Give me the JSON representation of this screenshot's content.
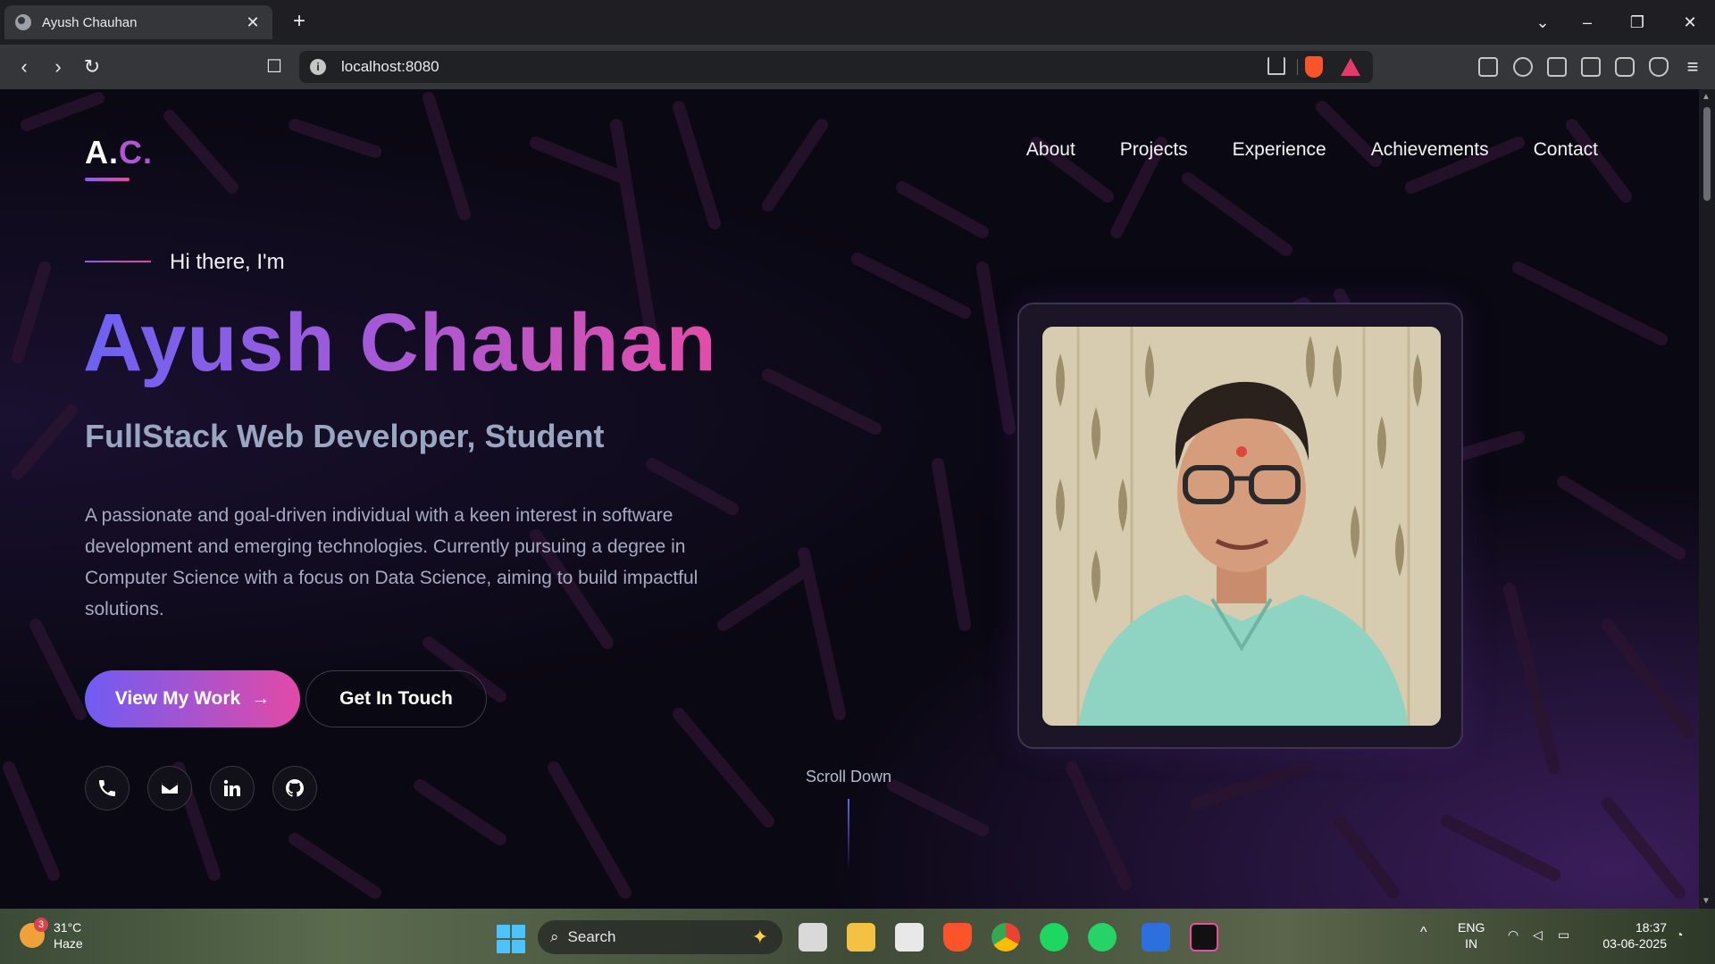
{
  "browser": {
    "tab_title": "Ayush Chauhan",
    "tab_close": "✕",
    "new_tab": "+",
    "url": "localhost:8080"
  },
  "site": {
    "logo": {
      "main": "A.",
      "accent": "C."
    },
    "nav": [
      "About",
      "Projects",
      "Experience",
      "Achievements",
      "Contact"
    ],
    "hero": {
      "greeting": "Hi there, I'm",
      "name": "Ayush Chauhan",
      "role": "FullStack Web Developer, Student",
      "description": "A passionate and goal-driven individual with a keen interest in software development and emerging technologies. Currently pursuing a degree in Computer Science with a focus on Data Science, aiming to build impactful solutions.",
      "primary_button": "View My Work",
      "secondary_button": "Get In Touch",
      "scroll_text": "Scroll Down"
    },
    "socials": [
      "phone-icon",
      "mail-icon",
      "linkedin-icon",
      "github-icon"
    ],
    "colors": {
      "gradient_start": "#6c62f2",
      "gradient_end": "#e34da8",
      "background": "#0a0813"
    }
  },
  "taskbar": {
    "weather": {
      "temp": "31°C",
      "condition": "Haze",
      "badge": "3"
    },
    "search_placeholder": "Search",
    "language": {
      "line1": "ENG",
      "line2": "IN"
    },
    "time": "18:37",
    "date": "03-06-2025"
  }
}
